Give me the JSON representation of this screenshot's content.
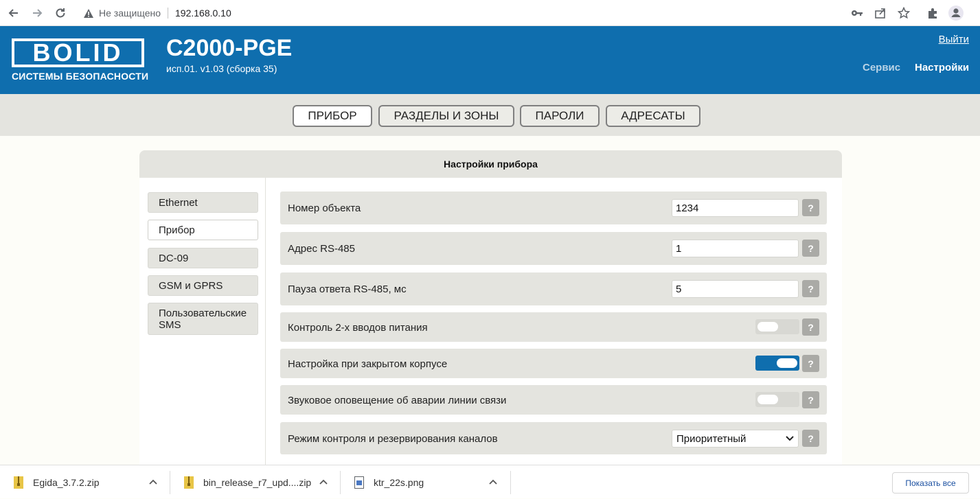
{
  "browser": {
    "insecure_label": "Не защищено",
    "url": "192.168.0.10",
    "icons": [
      "back-icon",
      "forward-icon",
      "reload-icon",
      "warning-icon",
      "key-icon",
      "share-icon",
      "star-icon",
      "extensions-icon",
      "profile-icon"
    ]
  },
  "header": {
    "logo_text": "BOLID",
    "logo_subtitle": "СИСТЕМЫ БЕЗОПАСНОСТИ",
    "device_title": "С2000-PGE",
    "device_version": "исп.01. v1.03 (сборка 35)",
    "logout": "Выйти",
    "service": "Сервис",
    "settings": "Настройки",
    "colors": {
      "brand": "#0f6eae",
      "service": "#b9d3e6",
      "settings": "#ffffff"
    }
  },
  "tabs": [
    {
      "label": "ПРИБОР",
      "active": true
    },
    {
      "label": "РАЗДЕЛЫ И ЗОНЫ",
      "active": false
    },
    {
      "label": "ПАРОЛИ",
      "active": false
    },
    {
      "label": "АДРЕСАТЫ",
      "active": false
    }
  ],
  "panel": {
    "title": "Настройки прибора",
    "sidebar": [
      {
        "label": "Ethernet",
        "active": false
      },
      {
        "label": "Прибор",
        "active": true
      },
      {
        "label": "DC-09",
        "active": false
      },
      {
        "label": "GSM и GPRS",
        "active": false
      },
      {
        "label": "Пользовательские SMS",
        "active": false
      }
    ],
    "help_label": "?",
    "rows": [
      {
        "label": "Номер объекта",
        "type": "input",
        "value": "1234"
      },
      {
        "label": "Адрес RS-485",
        "type": "input",
        "value": "1"
      },
      {
        "label": "Пауза ответа RS-485, мс",
        "type": "input",
        "value": "5"
      },
      {
        "label": "Контроль 2-х вводов питания",
        "type": "toggle",
        "on": false
      },
      {
        "label": "Настройка при закрытом корпусе",
        "type": "toggle",
        "on": true
      },
      {
        "label": "Звуковое оповещение об аварии линии связи",
        "type": "toggle",
        "on": false
      },
      {
        "label": "Режим контроля и резервирования каналов",
        "type": "select",
        "value": "Приоритетный"
      }
    ]
  },
  "downloads": {
    "items": [
      "Egida_3.7.2.zip",
      "bin_release_r7_upd....zip",
      "ktr_22s.png"
    ],
    "show_all": "Показать все"
  }
}
